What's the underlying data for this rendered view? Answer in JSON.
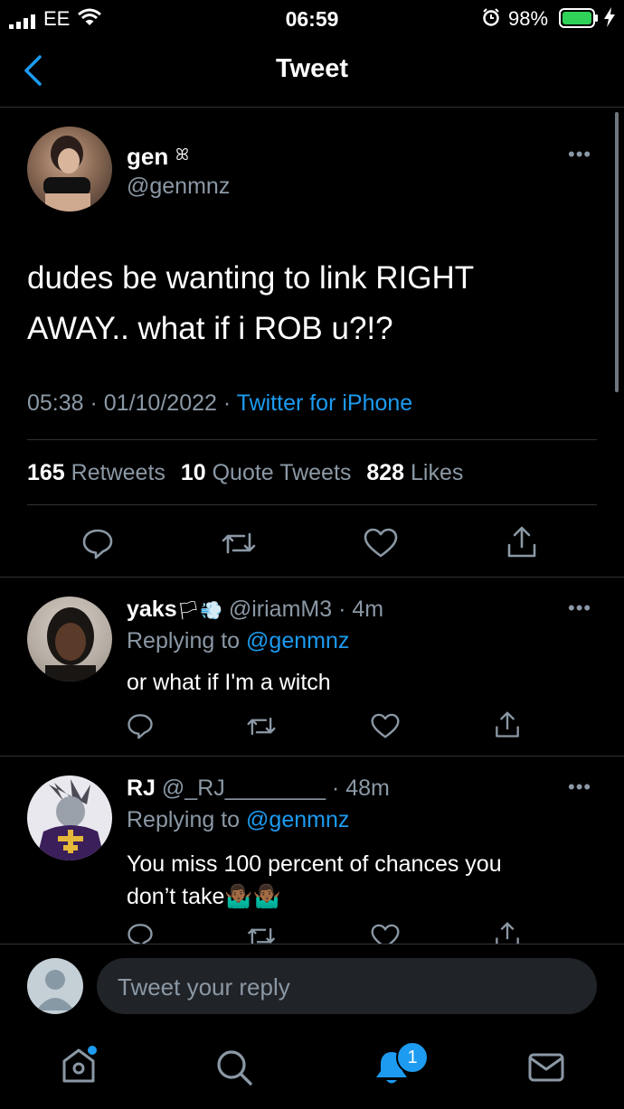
{
  "status_bar": {
    "carrier": "EE",
    "time": "06:59",
    "battery": "98%"
  },
  "header": {
    "title": "Tweet"
  },
  "main_tweet": {
    "name": "gen",
    "name_badge": "ꕤ",
    "handle": "@genmnz",
    "text_line1": "dudes be wanting to link RIGHT",
    "text_line2": "AWAY.. what if i ROB u?!?",
    "timestamp": "05:38 · 01/10/2022 ·",
    "source": "Twitter for iPhone",
    "retweets_count": "165",
    "retweets_label": "Retweets",
    "quotes_count": "10",
    "quotes_label": "Quote Tweets",
    "likes_count": "828",
    "likes_label": "Likes"
  },
  "replies": [
    {
      "name": "yaks",
      "name_emoji": "🏳💨",
      "handle_time": "@iriamM3 · 4m",
      "replying_prefix": "Replying to",
      "replying_to": "@genmnz",
      "text_line1": "or what if I'm a witch",
      "text_line2": ""
    },
    {
      "name": "RJ",
      "name_emoji": "",
      "handle_time": "@_RJ________ · 48m",
      "replying_prefix": "Replying to",
      "replying_to": "@genmnz",
      "text_line1": "You miss 100 percent of chances you",
      "text_line2": "don’t take🤷🏾‍♂️🤷🏾‍♂️"
    }
  ],
  "reply_box": {
    "placeholder": "Tweet your reply"
  },
  "tab_bar": {
    "notifications_badge": "1"
  },
  "colors": {
    "accent": "#1d9bf0",
    "muted": "#8b98a5",
    "background": "#000000"
  }
}
